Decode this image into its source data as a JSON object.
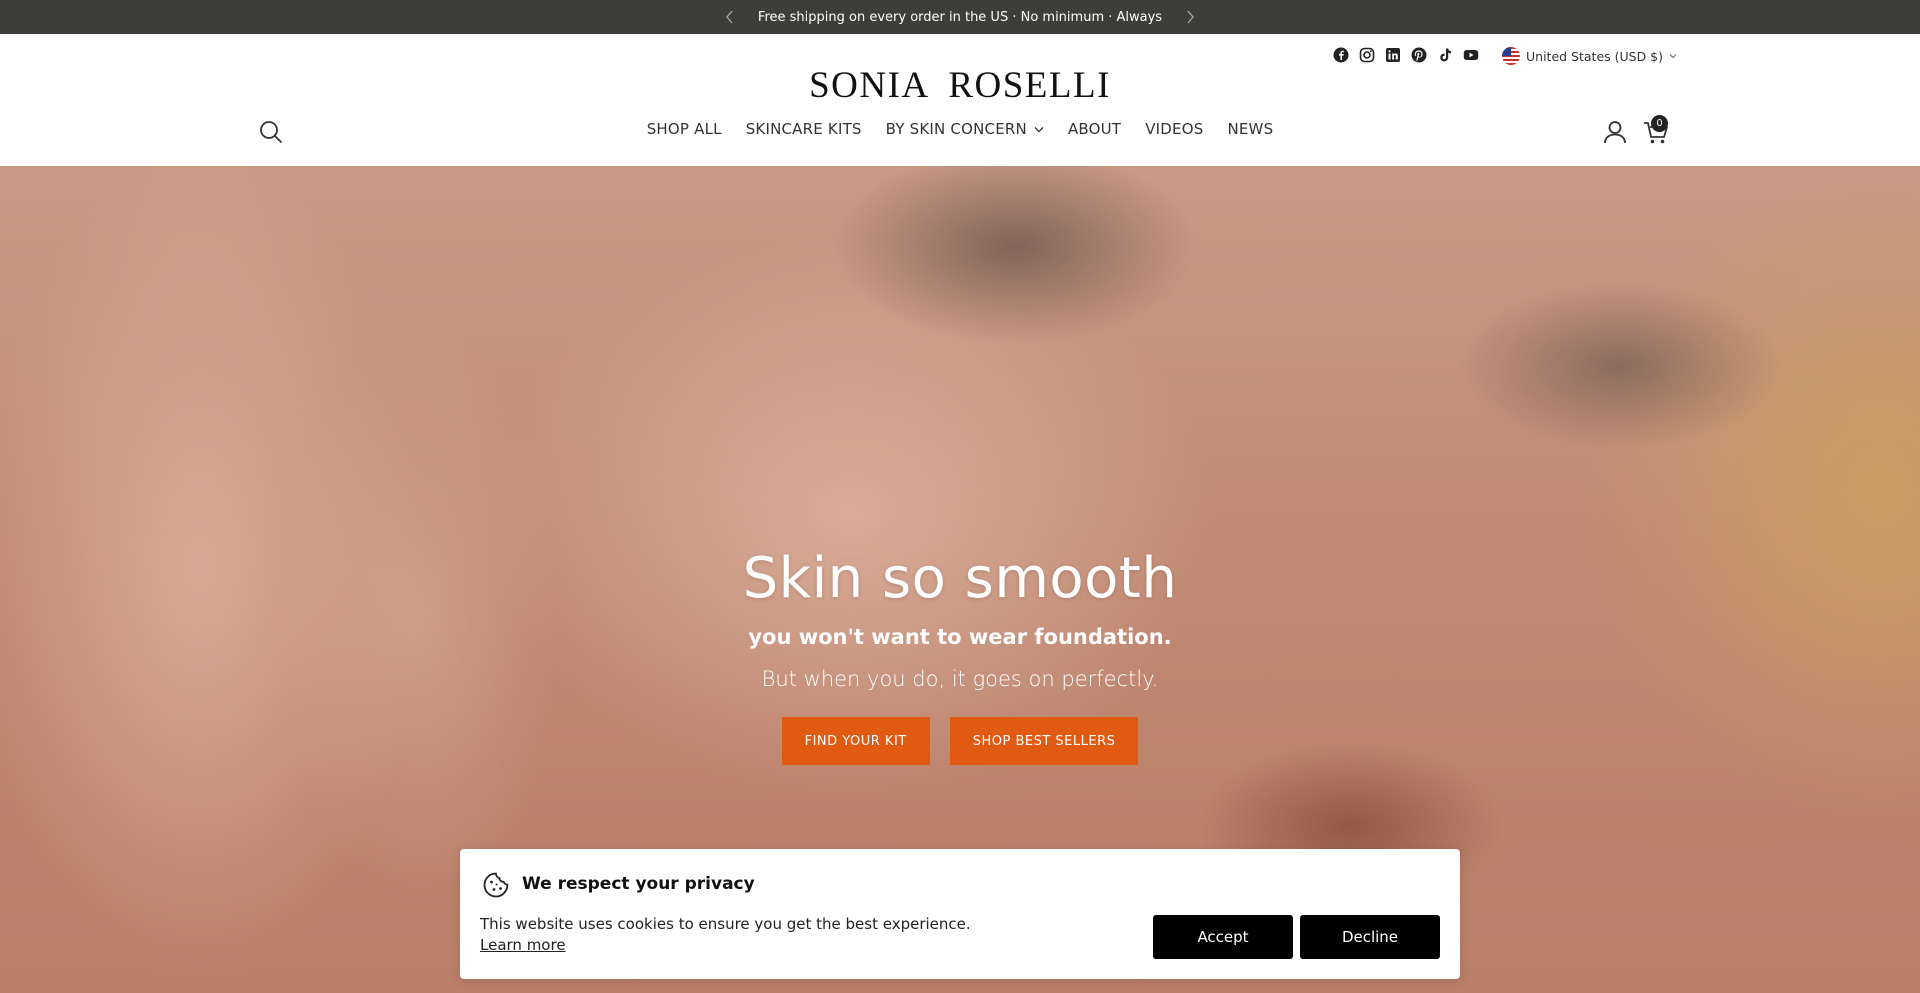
{
  "announcement": {
    "text": "Free shipping on every order in the US · No minimum · Always"
  },
  "header": {
    "logo": "SONIA ROSELLI",
    "socials": [
      "facebook-icon",
      "instagram-icon",
      "linkedin-icon",
      "pinterest-icon",
      "tiktok-icon",
      "youtube-icon"
    ],
    "locale": "United States (USD $)",
    "cart_count": "0"
  },
  "nav": {
    "items": [
      {
        "label": "SHOP ALL"
      },
      {
        "label": "SKINCARE KITS"
      },
      {
        "label": "BY SKIN CONCERN"
      },
      {
        "label": "ABOUT"
      },
      {
        "label": "VIDEOS"
      },
      {
        "label": "NEWS"
      }
    ]
  },
  "hero": {
    "title": "Skin so smooth",
    "subtitle": "you won't want to wear foundation.",
    "tagline": "But when you do, it goes on perfectly.",
    "primary_button": "FIND YOUR KIT",
    "secondary_button": "SHOP BEST SELLERS",
    "button_color": "#e05a12"
  },
  "cookie": {
    "title": "We respect your privacy",
    "text": "This website uses cookies to ensure you get the best experience.",
    "link": "Learn more",
    "accept": "Accept",
    "decline": "Decline"
  }
}
